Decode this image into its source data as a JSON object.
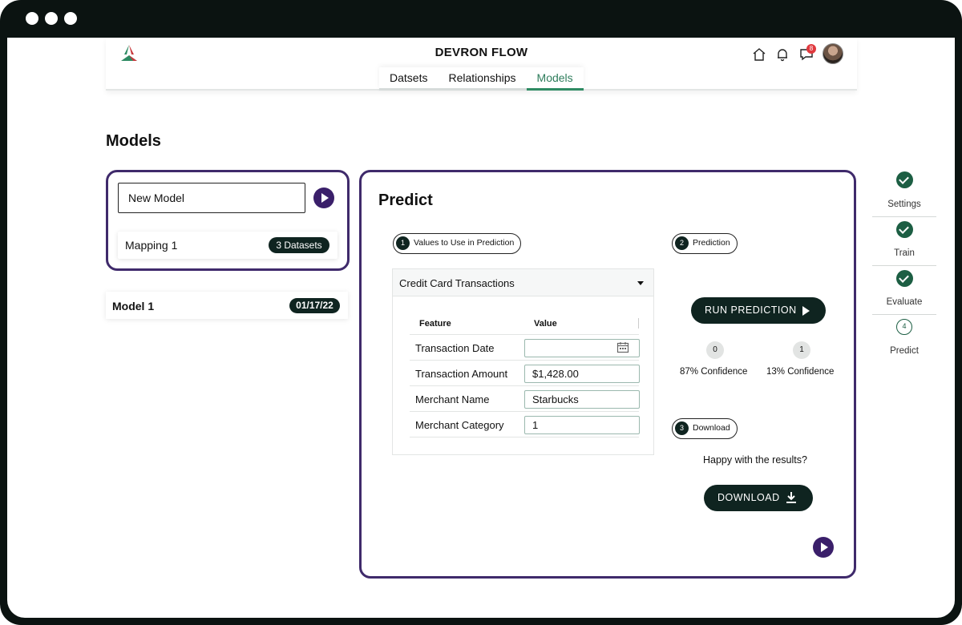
{
  "app": {
    "title": "DEVRON FLOW",
    "notifications_count": "8"
  },
  "nav": {
    "tabs": [
      {
        "label": "Datsets"
      },
      {
        "label": "Relationships"
      },
      {
        "label": "Models",
        "active": true
      }
    ]
  },
  "page": {
    "title": "Models"
  },
  "new_model": {
    "name": "New Model",
    "mapping": {
      "label": "Mapping 1",
      "datasets_badge": "3 Datasets"
    }
  },
  "models": [
    {
      "name": "Model 1",
      "date": "01/17/22"
    }
  ],
  "predict": {
    "title": "Predict",
    "step1": {
      "number": "1",
      "label": "Values to Use in Prediction"
    },
    "step2": {
      "number": "2",
      "label": "Prediction"
    },
    "step3": {
      "number": "3",
      "label": "Download"
    },
    "dataset_select": "Credit Card Transactions",
    "table": {
      "headers": [
        "Feature",
        "Value"
      ],
      "rows": [
        {
          "feature": "Transaction Date",
          "value": ""
        },
        {
          "feature": "Transaction Amount",
          "value": "$1,428.00"
        },
        {
          "feature": "Merchant Name",
          "value": "Starbucks"
        },
        {
          "feature": "Merchant Category",
          "value": "1"
        }
      ]
    },
    "run_label": "RUN PREDICTION",
    "results": [
      {
        "class": "0",
        "confidence": "87% Confidence"
      },
      {
        "class": "1",
        "confidence": "13% Confidence"
      }
    ],
    "happy_text": "Happy with the results?",
    "download_label": "DOWNLOAD"
  },
  "stepper": {
    "steps": [
      {
        "label": "Settings",
        "state": "done"
      },
      {
        "label": "Train",
        "state": "done"
      },
      {
        "label": "Evaluate",
        "state": "done"
      },
      {
        "label": "Predict",
        "state": "current",
        "number": "4"
      }
    ]
  },
  "colors": {
    "frame": "#0b1311",
    "accent_purple": "#3f2a6b",
    "dark_button": "#0f2420",
    "active_tab": "#2e8b63",
    "check_green": "#1c5e43",
    "badge_red": "#e0393e"
  }
}
